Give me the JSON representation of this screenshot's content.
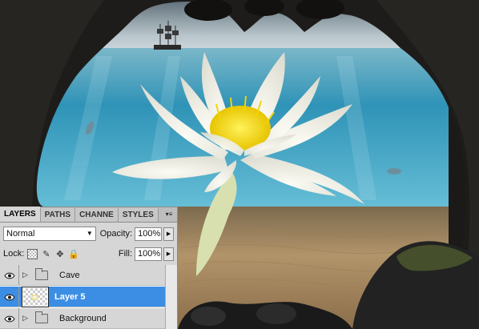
{
  "panel": {
    "tabs": [
      "LAYERS",
      "PATHS",
      "CHANNE",
      "STYLES"
    ],
    "active_tab": "LAYERS",
    "blend_mode": "Normal",
    "opacity_label": "Opacity:",
    "opacity_value": "100%",
    "lock_label": "Lock:",
    "fill_label": "Fill:",
    "fill_value": "100%"
  },
  "layers": [
    {
      "name": "Cave",
      "type": "group",
      "visible": true,
      "selected": false
    },
    {
      "name": "Layer 5",
      "type": "pixel",
      "visible": true,
      "selected": true
    },
    {
      "name": "Background",
      "type": "group",
      "visible": true,
      "selected": false
    }
  ],
  "colors": {
    "selection": "#3c8ee4",
    "panel_bg": "#d6d6d6",
    "water": "#4fa9c9",
    "sand": "#b59466",
    "lily_center": "#f4df1c"
  }
}
